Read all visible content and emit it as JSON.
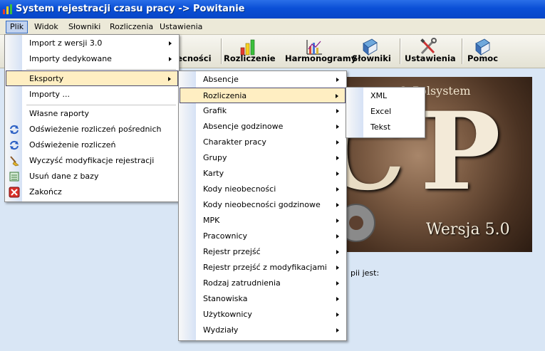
{
  "window": {
    "title": "System rejestracji czasu pracy -> Powitanie"
  },
  "menubar": [
    {
      "label": "Plik",
      "active": true
    },
    {
      "label": "Widok"
    },
    {
      "label": "Słowniki"
    },
    {
      "label": "Rozliczenia"
    },
    {
      "label": "Ustawienia"
    }
  ],
  "toolbar": {
    "absences_label": "becności",
    "billing_label": "Rozliczenie",
    "schedules_label": "Harmonogramy",
    "dictionaries_label": "Słowniki",
    "settings_label": "Ustawienia",
    "help_label": "Pomoc"
  },
  "splash": {
    "brand": "© Polsystem",
    "letter_c": "C",
    "letter_p": "P",
    "version": "Wersja 5.0"
  },
  "body": {
    "text_fragment": "pii jest:"
  },
  "plik_menu": [
    {
      "label": "Import z wersji 3.0",
      "submenu": true
    },
    {
      "label": "Importy dedykowane",
      "submenu": true
    },
    {
      "label": "Eksporty",
      "submenu": true,
      "selected": true
    },
    {
      "label": "Importy ..."
    },
    {
      "label": "Własne raporty"
    },
    {
      "label": "Odświeżenie rozliczeń pośrednich",
      "icon": "refresh-icon"
    },
    {
      "label": "Odświeżenie rozliczeń",
      "icon": "refresh-icon"
    },
    {
      "label": "Wyczyść modyfikacje rejestracji",
      "icon": "broom-icon"
    },
    {
      "label": "Usuń dane z bazy",
      "icon": "delete-data-icon"
    },
    {
      "label": "Zakończ",
      "icon": "exit-icon"
    }
  ],
  "eksporty_menu": [
    "Absencje",
    "Rozliczenia",
    "Grafik",
    "Absencje godzinowe",
    "Charakter pracy",
    "Grupy",
    "Karty",
    "Kody nieobecności",
    "Kody nieobecności godzinowe",
    "MPK",
    "Pracownicy",
    "Rejestr przejść",
    "Rejestr przejść z modyfikacjami",
    "Rodzaj zatrudnienia",
    "Stanowiska",
    "Użytkownicy",
    "Wydziały"
  ],
  "rozliczenia_menu": [
    "XML",
    "Excel",
    "Tekst"
  ],
  "colors": {
    "title_bar": "#0a4fd6",
    "menu_highlight": "#ffeec2",
    "background": "#d9e6f5"
  }
}
